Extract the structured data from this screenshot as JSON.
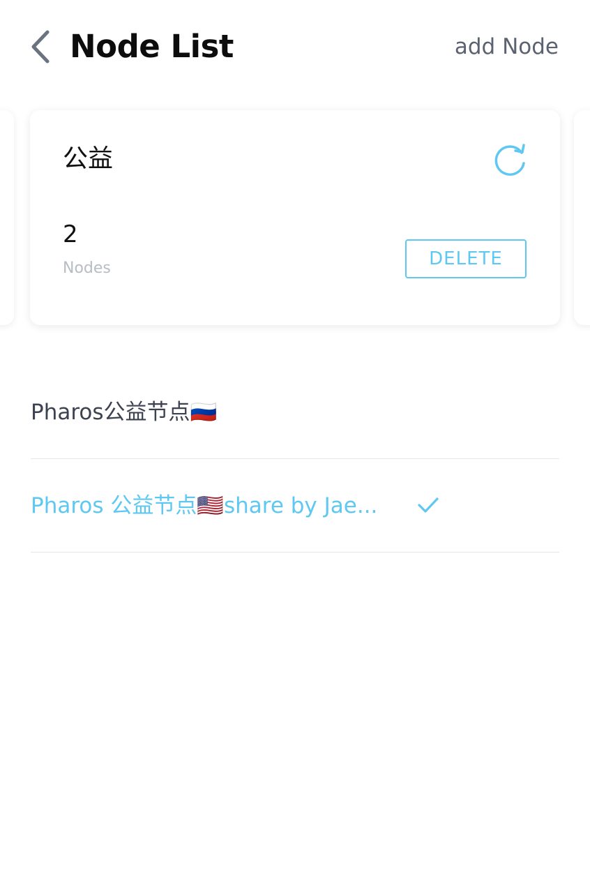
{
  "header": {
    "title": "Node List",
    "add_label": "add Node"
  },
  "group_card": {
    "name": "公益",
    "count": "2",
    "count_label": "Nodes",
    "delete_label": "DELETE"
  },
  "nodes": [
    {
      "name": "Pharos公益节点🇷🇺",
      "selected": false
    },
    {
      "name": "Pharos 公益节点🇺🇸share by Jae...",
      "selected": true
    }
  ],
  "icons": {
    "back": "chevron-left-icon",
    "refresh": "refresh-icon",
    "check": "checkmark-icon"
  },
  "colors": {
    "accent": "#5ec8f2",
    "title": "#0d0d0d",
    "secondary_text": "#5b6270",
    "muted_text": "#b8bcc3",
    "divider": "#e4e6ea"
  }
}
